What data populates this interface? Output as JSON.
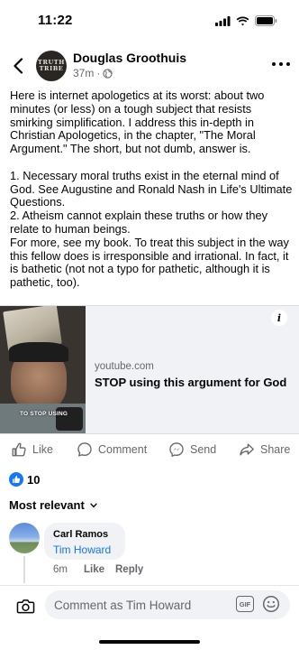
{
  "status_bar": {
    "time": "11:22"
  },
  "post": {
    "author": "Douglas Groothuis",
    "avatar_text": [
      "TRUTH",
      "TRIBE"
    ],
    "timestamp": "37m",
    "paragraphs": [
      "Here is internet apologetics at its worst: about two minutes (or less) on a tough subject that resists smirking simplification. I address this in-depth in Christian Apologetics, in the chapter, \"The Moral Argument.\" The short, but not dumb, answer is.",
      "",
      "1. Necessary moral truths exist in the eternal mind of God. See Augustine and Ronald Nash in Life's Ultimate Questions.",
      "2. Atheism cannot explain these truths or how they relate to human beings.",
      "For more, see my book. To treat this subject in the way this fellow does is irresponsible and irrational. In fact, it is bathetic (not not a typo for pathetic, although it is pathetic, too)."
    ]
  },
  "link_card": {
    "thumbnail_caption": "TO STOP USING",
    "domain": "youtube.com",
    "title": "STOP using this argument for God"
  },
  "actions": {
    "like": "Like",
    "comment": "Comment",
    "send": "Send",
    "share": "Share"
  },
  "reactions": {
    "count": "10"
  },
  "comments_sort": {
    "label": "Most relevant"
  },
  "comment": {
    "name": "Carl Ramos",
    "text": "Tim Howard",
    "time": "6m",
    "like_label": "Like",
    "reply_label": "Reply"
  },
  "composer": {
    "placeholder": "Comment as Tim Howard",
    "gif_label": "GIF"
  },
  "colors": {
    "accent_blue": "#1877f2",
    "link_blue": "#1b74e4",
    "secondary_text": "#65676b"
  }
}
